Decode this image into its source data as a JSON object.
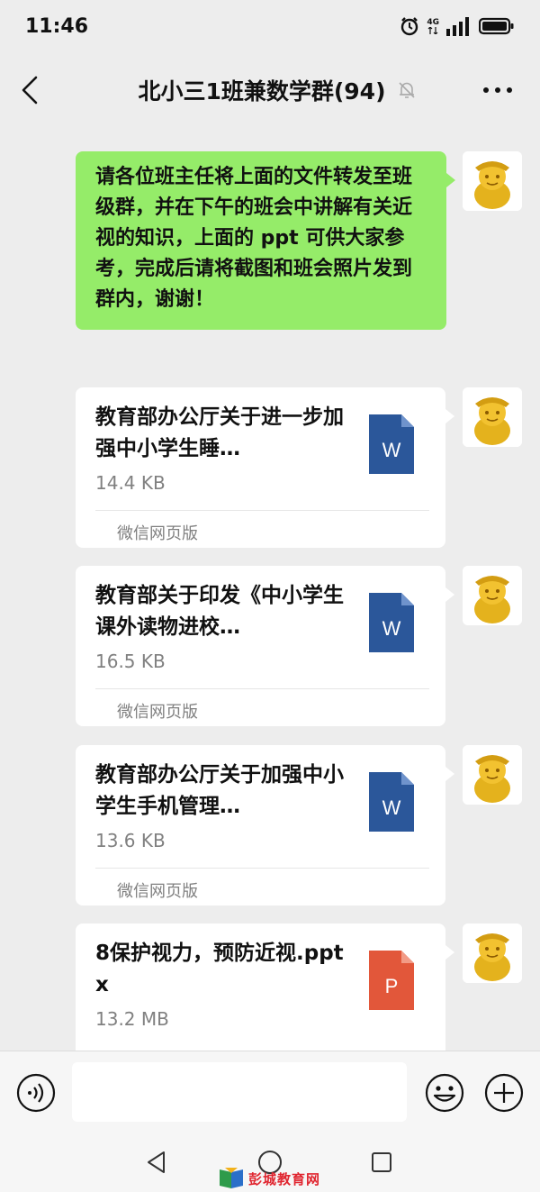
{
  "status": {
    "time": "11:46",
    "network": "4G"
  },
  "header": {
    "title": "北小三1班兼数学群(94)"
  },
  "messages": {
    "text_message": "请各位班主任将上面的文件转发至班级群，并在下午的班会中讲解有关近视的知识，上面的 ppt 可供大家参考，完成后请将截图和班会照片发到群内，谢谢！",
    "files": [
      {
        "name": "教育部办公厅关于进一步加强中小学生睡…",
        "size": "14.4 KB",
        "source": "微信网页版",
        "type_letter": "W",
        "color": "#2b579a"
      },
      {
        "name": "教育部关于印发《中小学生课外读物进校…",
        "size": "16.5 KB",
        "source": "微信网页版",
        "type_letter": "W",
        "color": "#2b579a"
      },
      {
        "name": "教育部办公厅关于加强中小学生手机管理…",
        "size": "13.6 KB",
        "source": "微信网页版",
        "type_letter": "W",
        "color": "#2b579a"
      },
      {
        "name": "8保护视力，预防近视.pptx",
        "size": "13.2 MB",
        "type_letter": "P",
        "color": "#e2573a"
      }
    ]
  },
  "colors": {
    "sent_bubble": "#95ec69",
    "background": "#ededed",
    "watermark": "#e0252f"
  },
  "icons": {
    "back": "chevron-left-icon",
    "mute": "bell-off-icon",
    "more": "ellipsis-icon",
    "voice": "voice-icon",
    "emoji": "emoji-icon",
    "plus": "plus-icon"
  },
  "watermark": {
    "text": "彭城教育网"
  }
}
